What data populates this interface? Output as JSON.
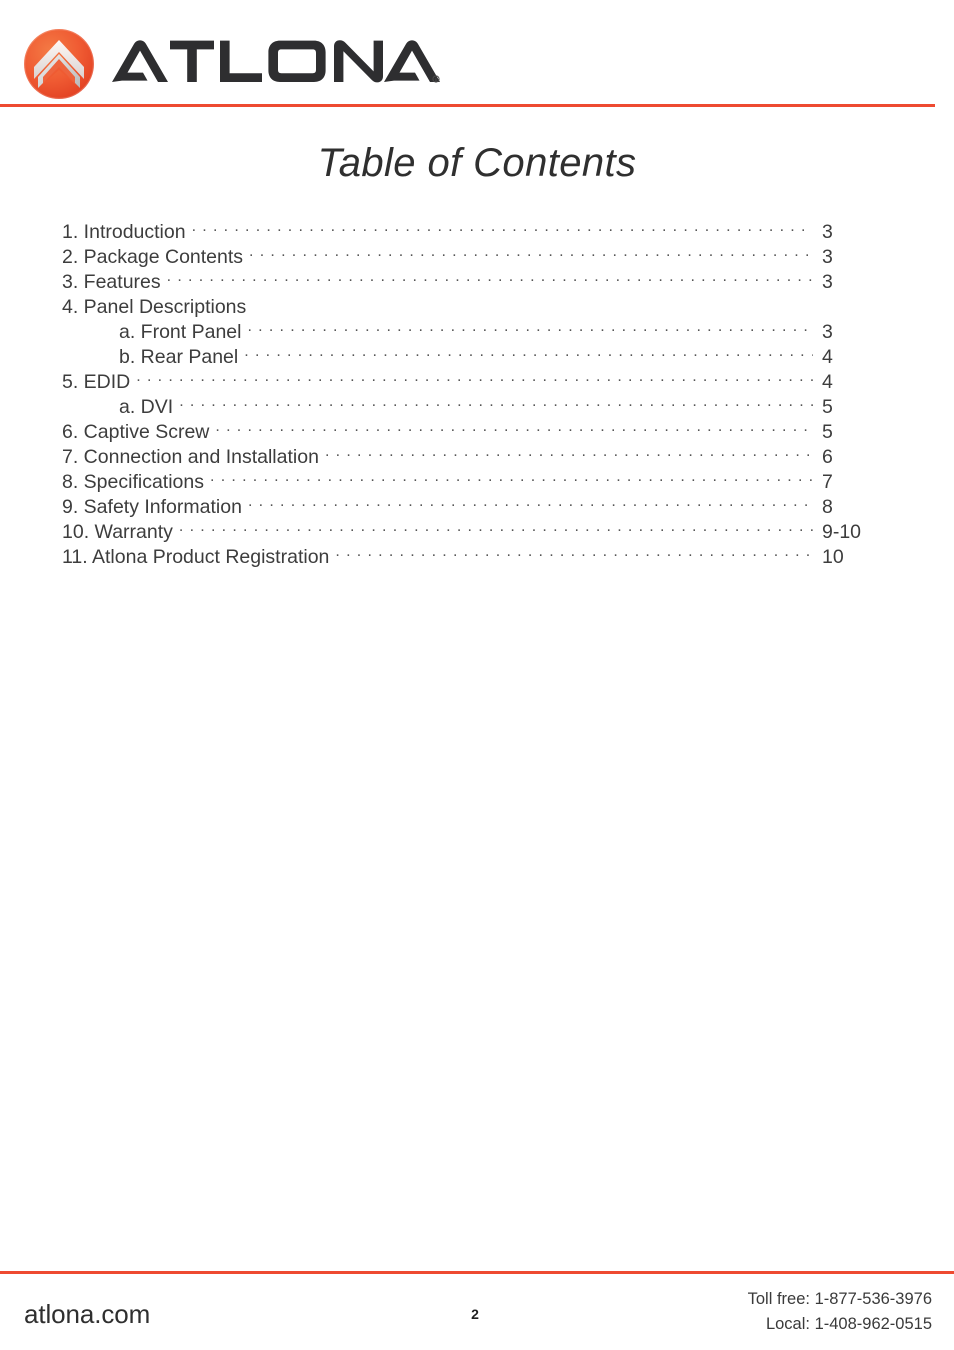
{
  "header": {
    "logo_icon": "atlona-chevron-circle-logo",
    "wordmark_text": "ATLONA",
    "wordmark_trademark": "®",
    "rule_color": "#ee4a31"
  },
  "title": "Table of Contents",
  "toc": {
    "entries": [
      {
        "label": "1. Introduction",
        "page": "3",
        "sub": false,
        "leader": true
      },
      {
        "label": "2. Package Contents",
        "page": "3",
        "sub": false,
        "leader": true
      },
      {
        "label": "3. Features",
        "page": "3",
        "sub": false,
        "leader": true
      },
      {
        "label": "4. Panel Descriptions",
        "page": "",
        "sub": false,
        "leader": false
      },
      {
        "label": "a. Front Panel",
        "page": "3",
        "sub": true,
        "leader": true
      },
      {
        "label": "b. Rear Panel",
        "page": "4",
        "sub": true,
        "leader": true
      },
      {
        "label": "5. EDID",
        "page": "4",
        "sub": false,
        "leader": true
      },
      {
        "label": "a. DVI",
        "page": "5",
        "sub": true,
        "leader": true
      },
      {
        "label": "6. Captive Screw",
        "page": "5",
        "sub": false,
        "leader": true
      },
      {
        "label": "7. Connection and Installation",
        "page": "6",
        "sub": false,
        "leader": true
      },
      {
        "label": "8. Specifications",
        "page": "7",
        "sub": false,
        "leader": true
      },
      {
        "label": "9. Safety Information",
        "page": "8",
        "sub": false,
        "leader": true
      },
      {
        "label": "10. Warranty",
        "page": "9-10",
        "sub": false,
        "leader": true
      },
      {
        "label": "11. Atlona Product Registration",
        "page": "10",
        "sub": false,
        "leader": true
      }
    ]
  },
  "footer": {
    "site": "atlona.com",
    "page_number": "2",
    "toll_free": "Toll free: 1-877-536-3976",
    "local": "Local: 1-408-962-0515",
    "rule_color": "#ee4a31"
  }
}
